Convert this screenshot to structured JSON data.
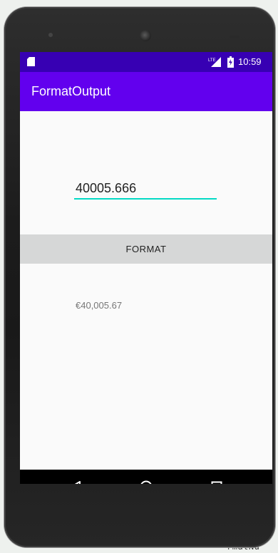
{
  "status_bar": {
    "time": "10:59",
    "icons": [
      "sd-card-icon",
      "signal-icon",
      "battery-charging-icon"
    ]
  },
  "app_bar": {
    "title": "FormatOutput"
  },
  "input": {
    "value": "40005.666"
  },
  "format_button": {
    "label": "FORMAT"
  },
  "result": {
    "text": "€40,005.67"
  },
  "nav_bar": {
    "icons": [
      "back-icon",
      "home-icon",
      "recents-icon"
    ]
  },
  "background": {
    "caption": "rmatNu"
  },
  "colors": {
    "status_bar": "#3700b3",
    "app_bar": "#6200ee",
    "accent": "#03dac5",
    "button": "#d6d7d7",
    "screen": "#fafafa"
  }
}
